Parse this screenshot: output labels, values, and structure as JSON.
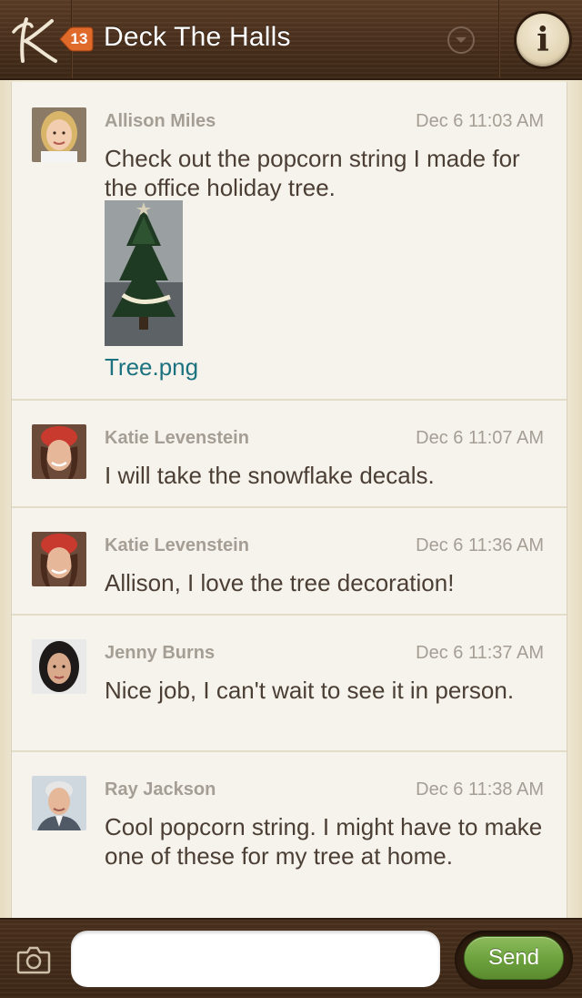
{
  "header": {
    "title": "Deck The Halls",
    "unread_count": "13",
    "logo_icon": "k-logo-icon",
    "dropdown_icon": "chevron-down-circle-icon",
    "info_label": "i"
  },
  "messages": [
    {
      "author": "Allison Miles",
      "timestamp": "Dec 6 11:03 AM",
      "text": "Check out the popcorn string I made for the office holiday tree.",
      "attachment": {
        "filename": "Tree.png",
        "thumbnail": "christmas-tree-photo"
      }
    },
    {
      "author": "Katie Levenstein",
      "timestamp": "Dec 6 11:07 AM",
      "text": "I will take the snowflake decals."
    },
    {
      "author": "Katie Levenstein",
      "timestamp": "Dec 6 11:36 AM",
      "text": "Allison, I love the tree decoration!"
    },
    {
      "author": "Jenny Burns",
      "timestamp": "Dec 6 11:37 AM",
      "text": "Nice job, I can't wait to see it in person."
    },
    {
      "author": "Ray Jackson",
      "timestamp": "Dec 6 11:38 AM",
      "text": "Cool popcorn string. I might have to make one of these for my tree at home."
    }
  ],
  "composer": {
    "placeholder": "",
    "value": "",
    "send_label": "Send",
    "camera_icon": "camera-icon"
  },
  "colors": {
    "header_wood": "#4a301d",
    "feed_background": "#f6f3ec",
    "meta_text": "#a59e95",
    "body_text": "#4b3f35",
    "link": "#1d7280",
    "badge": "#e06a2a",
    "send_button": "#6ea33f"
  }
}
